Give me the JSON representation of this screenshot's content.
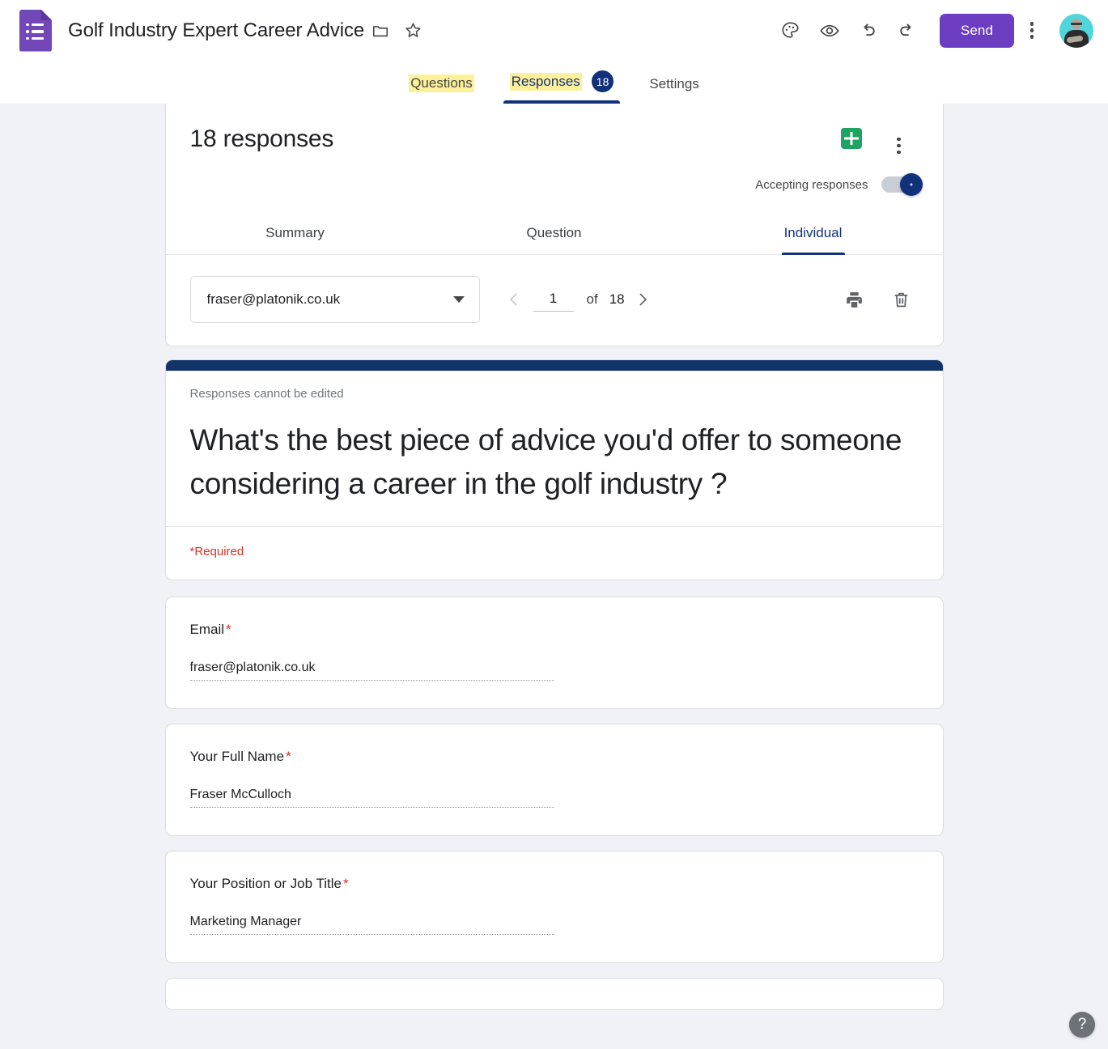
{
  "app": {
    "logo_icon": "google-forms-icon",
    "doc_title": "Golf Industry Expert Career Advice",
    "move_icon": "folder-icon",
    "star_icon": "star-icon",
    "theme_icon": "palette-icon",
    "preview_icon": "eye-icon",
    "undo_icon": "undo-icon",
    "redo_icon": "redo-icon",
    "send_label": "Send",
    "more_icon": "more-vert-icon",
    "avatar_icon": "user-avatar"
  },
  "tabs": [
    {
      "label": "Questions",
      "active": false,
      "highlighted": true,
      "badge": null
    },
    {
      "label": "Responses",
      "active": true,
      "highlighted": true,
      "badge": "18"
    },
    {
      "label": "Settings",
      "active": false,
      "highlighted": false,
      "badge": null
    }
  ],
  "responses": {
    "heading": "18 responses",
    "sheets_icon": "google-sheets-icon",
    "more_icon": "more-vert-icon",
    "accepting_label": "Accepting responses",
    "accepting_on": true,
    "subtabs": [
      {
        "label": "Summary",
        "active": false
      },
      {
        "label": "Question",
        "active": false
      },
      {
        "label": "Individual",
        "active": true
      }
    ],
    "respondent_selected": "fraser@platonik.co.uk",
    "dropdown_icon": "chevron-down-icon",
    "prev_icon": "chevron-left-icon",
    "next_icon": "chevron-right-icon",
    "page_current": "1",
    "page_of_label": "of",
    "page_total": "18",
    "print_icon": "print-icon",
    "delete_icon": "trash-icon"
  },
  "question_header": {
    "note": "Responses cannot be edited",
    "title": "What's the best piece of advice you'd offer to someone considering a career in the golf industry ?",
    "required_note": "*Required"
  },
  "answers": [
    {
      "label": "Email",
      "required": "*",
      "value": "fraser@platonik.co.uk"
    },
    {
      "label": "Your Full Name",
      "required": "*",
      "value": "Fraser McCulloch"
    },
    {
      "label": "Your Position or Job Title",
      "required": "*",
      "value": "Marketing Manager"
    }
  ],
  "help": {
    "icon": "help-icon",
    "label": "?"
  },
  "colors": {
    "accent_purple": "#6c3dc0",
    "accent_navy": "#11327a",
    "header_bar_navy": "#113469",
    "sheets_green": "#1ea362",
    "required_red": "#d93025",
    "highlight_yellow": "#fdf09a",
    "page_background": "#f0f2f7"
  }
}
